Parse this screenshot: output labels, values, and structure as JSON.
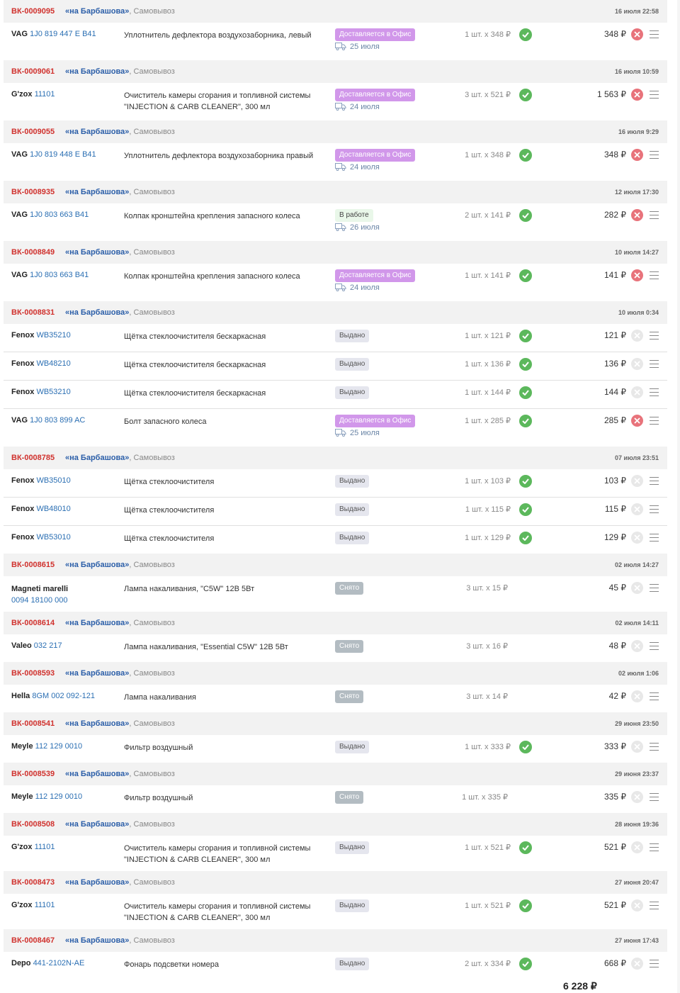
{
  "store_name": "«на Барбашова»",
  "store_suffix": ", Самовывоз",
  "icons": {
    "delivery": "truck-icon",
    "ok": "check-circle-icon",
    "cancel": "cancel-x-icon",
    "menu": "menu-lines-icon"
  },
  "colors": {
    "order_id": "#d0312d",
    "purple_status": "#d197ea",
    "ok": "#5cb85c",
    "cancel_active": "#e8737b"
  },
  "orders": [
    {
      "id": "ВК-0009095",
      "date": "16 июля 22:58",
      "items": [
        {
          "brand": "VAG",
          "code": "1J0 819 447 E B41",
          "name": "Уплотнитель дефлектора воздухозаборника, левый",
          "status": "Доставляется в Офис",
          "status_kind": "purple",
          "delivery": "25 июля",
          "qty": "1 шт. x 348 ₽",
          "checked": true,
          "sum": "348 ₽",
          "cancel": true
        }
      ]
    },
    {
      "id": "ВК-0009061",
      "date": "16 июля 10:59",
      "items": [
        {
          "brand": "G'zox",
          "code": "11101",
          "name": "Очиститель камеры сгорания и топливной системы \"INJECTION & CARB CLEANER\", 300 мл",
          "status": "Доставляется в Офис",
          "status_kind": "purple",
          "delivery": "24 июля",
          "qty": "3 шт. x 521 ₽",
          "checked": true,
          "sum": "1 563 ₽",
          "cancel": true
        }
      ]
    },
    {
      "id": "ВК-0009055",
      "date": "16 июля 9:29",
      "items": [
        {
          "brand": "VAG",
          "code": "1J0 819 448 E B41",
          "name": "Уплотнитель дефлектора воздухозаборника правый",
          "status": "Доставляется в Офис",
          "status_kind": "purple",
          "delivery": "24 июля",
          "qty": "1 шт. x 348 ₽",
          "checked": true,
          "sum": "348 ₽",
          "cancel": true
        }
      ]
    },
    {
      "id": "ВК-0008935",
      "date": "12 июля 17:30",
      "items": [
        {
          "brand": "VAG",
          "code": "1J0 803 663 B41",
          "name": "Колпак кронштейна крепления запасного колеса",
          "status": "В работе",
          "status_kind": "green",
          "delivery": "26 июля",
          "qty": "2 шт. x 141 ₽",
          "checked": true,
          "sum": "282 ₽",
          "cancel": true
        }
      ]
    },
    {
      "id": "ВК-0008849",
      "date": "10 июля 14:27",
      "items": [
        {
          "brand": "VAG",
          "code": "1J0 803 663 B41",
          "name": "Колпак кронштейна крепления запасного колеса",
          "status": "Доставляется в Офис",
          "status_kind": "purple",
          "delivery": "24 июля",
          "qty": "1 шт. x 141 ₽",
          "checked": true,
          "sum": "141 ₽",
          "cancel": true
        }
      ]
    },
    {
      "id": "ВК-0008831",
      "date": "10 июля 0:34",
      "items": [
        {
          "brand": "Fenox",
          "code": "WB35210",
          "name": "Щётка стеклоочистителя бескаркасная",
          "status": "Выдано",
          "status_kind": "gray",
          "qty": "1 шт. x 121 ₽",
          "checked": true,
          "sum": "121 ₽",
          "cancel": false
        },
        {
          "brand": "Fenox",
          "code": "WB48210",
          "name": "Щётка стеклоочистителя бескаркасная",
          "status": "Выдано",
          "status_kind": "gray",
          "qty": "1 шт. x 136 ₽",
          "checked": true,
          "sum": "136 ₽",
          "cancel": false
        },
        {
          "brand": "Fenox",
          "code": "WB53210",
          "name": "Щётка стеклоочистителя бескаркасная",
          "status": "Выдано",
          "status_kind": "gray",
          "qty": "1 шт. x 144 ₽",
          "checked": true,
          "sum": "144 ₽",
          "cancel": false
        },
        {
          "brand": "VAG",
          "code": "1J0 803 899 AC",
          "name": "Болт запасного колеса",
          "status": "Доставляется в Офис",
          "status_kind": "purple",
          "delivery": "25 июля",
          "qty": "1 шт. x 285 ₽",
          "checked": true,
          "sum": "285 ₽",
          "cancel": true
        }
      ]
    },
    {
      "id": "ВК-0008785",
      "date": "07 июля 23:51",
      "items": [
        {
          "brand": "Fenox",
          "code": "WB35010",
          "name": "Щётка стеклоочистителя",
          "status": "Выдано",
          "status_kind": "gray",
          "qty": "1 шт. x 103 ₽",
          "checked": true,
          "sum": "103 ₽",
          "cancel": false
        },
        {
          "brand": "Fenox",
          "code": "WB48010",
          "name": "Щётка стеклоочистителя",
          "status": "Выдано",
          "status_kind": "gray",
          "qty": "1 шт. x 115 ₽",
          "checked": true,
          "sum": "115 ₽",
          "cancel": false
        },
        {
          "brand": "Fenox",
          "code": "WB53010",
          "name": "Щётка стеклоочистителя",
          "status": "Выдано",
          "status_kind": "gray",
          "qty": "1 шт. x 129 ₽",
          "checked": true,
          "sum": "129 ₽",
          "cancel": false
        }
      ]
    },
    {
      "id": "ВК-0008615",
      "date": "02 июля 14:27",
      "items": [
        {
          "brand": "Magneti marelli",
          "code": "0094 18100 000",
          "wrap": true,
          "name": "Лампа накаливания, \"C5W\" 12В 5Вт",
          "status": "Снято",
          "status_kind": "dark",
          "qty": "3 шт. x 15 ₽",
          "checked": false,
          "sum": "45 ₽",
          "cancel": false
        }
      ]
    },
    {
      "id": "ВК-0008614",
      "date": "02 июля 14:11",
      "items": [
        {
          "brand": "Valeo",
          "code": "032 217",
          "name": "Лампа накаливания, \"Essential C5W\" 12В 5Вт",
          "status": "Снято",
          "status_kind": "dark",
          "qty": "3 шт. x 16 ₽",
          "checked": false,
          "sum": "48 ₽",
          "cancel": false
        }
      ]
    },
    {
      "id": "ВК-0008593",
      "date": "02 июля 1:06",
      "items": [
        {
          "brand": "Hella",
          "code": "8GM 002 092-121",
          "name": "Лампа накаливания",
          "status": "Снято",
          "status_kind": "dark",
          "qty": "3 шт. x 14 ₽",
          "checked": false,
          "sum": "42 ₽",
          "cancel": false
        }
      ]
    },
    {
      "id": "ВК-0008541",
      "date": "29 июня 23:50",
      "items": [
        {
          "brand": "Meyle",
          "code": "112 129 0010",
          "name": "Фильтр воздушный",
          "status": "Выдано",
          "status_kind": "gray",
          "qty": "1 шт. x 333 ₽",
          "checked": true,
          "sum": "333 ₽",
          "cancel": false
        }
      ]
    },
    {
      "id": "ВК-0008539",
      "date": "29 июня 23:37",
      "items": [
        {
          "brand": "Meyle",
          "code": "112 129 0010",
          "name": "Фильтр воздушный",
          "status": "Снято",
          "status_kind": "dark",
          "qty": "1 шт. x 335 ₽",
          "checked": false,
          "sum": "335 ₽",
          "cancel": false
        }
      ]
    },
    {
      "id": "ВК-0008508",
      "date": "28 июня 19:36",
      "items": [
        {
          "brand": "G'zox",
          "code": "11101",
          "name": "Очиститель камеры сгорания и топливной системы \"INJECTION & CARB CLEANER\", 300 мл",
          "status": "Выдано",
          "status_kind": "gray",
          "qty": "1 шт. x 521 ₽",
          "checked": true,
          "sum": "521 ₽",
          "cancel": false
        }
      ]
    },
    {
      "id": "ВК-0008473",
      "date": "27 июня 20:47",
      "items": [
        {
          "brand": "G'zox",
          "code": "11101",
          "name": "Очиститель камеры сгорания и топливной системы \"INJECTION & CARB CLEANER\", 300 мл",
          "status": "Выдано",
          "status_kind": "gray",
          "qty": "1 шт. x 521 ₽",
          "checked": true,
          "sum": "521 ₽",
          "cancel": false
        }
      ]
    },
    {
      "id": "ВК-0008467",
      "date": "27 июня 17:43",
      "items": [
        {
          "brand": "Depo",
          "code": "441-2102N-AE",
          "name": "Фонарь подсветки номера",
          "status": "Выдано",
          "status_kind": "gray",
          "qty": "2 шт. x 334 ₽",
          "checked": true,
          "sum": "668 ₽",
          "cancel": false
        }
      ]
    }
  ],
  "total": "6 228 ₽"
}
